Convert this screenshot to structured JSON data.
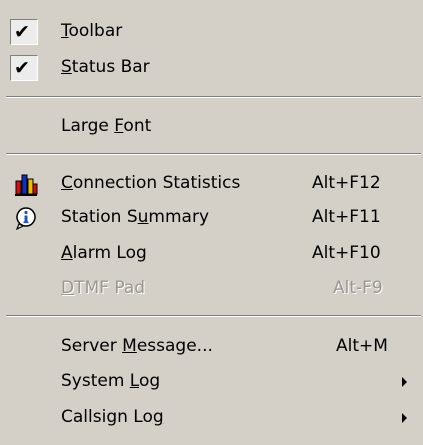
{
  "menu": {
    "items": [
      {
        "id": "toolbar",
        "pre": "",
        "acc": "T",
        "post": "oolbar",
        "checked": true,
        "shortcut": ""
      },
      {
        "id": "status-bar",
        "pre": "",
        "acc": "S",
        "post": "tatus Bar",
        "checked": true,
        "shortcut": ""
      },
      {
        "id": "large-font",
        "pre": "Large ",
        "acc": "F",
        "post": "ont",
        "checked": false,
        "shortcut": ""
      },
      {
        "id": "connection-statistics",
        "pre": "",
        "acc": "C",
        "post": "onnection Statistics",
        "icon": "bar-chart-icon",
        "shortcut": "Alt+F12"
      },
      {
        "id": "station-summary",
        "pre": "Station S",
        "acc": "u",
        "post": "mmary",
        "icon": "info-icon",
        "shortcut": "Alt+F11"
      },
      {
        "id": "alarm-log",
        "pre": "",
        "acc": "A",
        "post": "larm Log",
        "shortcut": "Alt+F10"
      },
      {
        "id": "dtmf-pad",
        "pre": "",
        "acc": "D",
        "post": "TMF Pad",
        "disabled": true,
        "shortcut": "Alt-F9"
      },
      {
        "id": "server-message",
        "pre": "Server ",
        "acc": "M",
        "post": "essage...",
        "shortcut": "Alt+M"
      },
      {
        "id": "system-log",
        "pre": "System ",
        "acc": "L",
        "post": "og",
        "submenu": true,
        "shortcut": ""
      },
      {
        "id": "callsign-log",
        "pre": "Callsign Lo",
        "acc": "g",
        "post": "",
        "submenu": true,
        "shortcut": ""
      }
    ]
  },
  "icons": {
    "check": "checkmark-icon",
    "submenu": "submenu-arrow-icon"
  },
  "colors": {
    "menu_bg": "#d4d0c8",
    "disabled_text": "#9a978f",
    "chart_red": "#d01010",
    "chart_blue": "#1030c0",
    "chart_yellow": "#f0c000",
    "info_blue": "#2050c8"
  }
}
